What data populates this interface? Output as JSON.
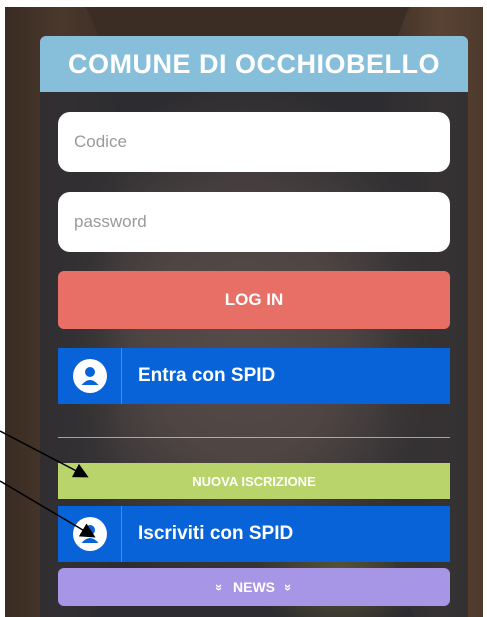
{
  "header": {
    "title": "COMUNE DI OCCHIOBELLO"
  },
  "login": {
    "code_placeholder": "Codice",
    "password_placeholder": "password",
    "login_label": "LOG IN",
    "spid_enter_label": "Entra con SPID"
  },
  "registration": {
    "new_label": "NUOVA ISCRIZIONE",
    "spid_register_label": "Iscriviti con SPID"
  },
  "news": {
    "label": "NEWS",
    "chevron_left": "»",
    "chevron_right": "»"
  },
  "colors": {
    "title_bar": "#87bfdb",
    "login_button": "#e76f66",
    "spid_button": "#0863d8",
    "new_registration": "#b8d46a",
    "news_button": "#a796e6"
  },
  "icons": {
    "spid": "user-circle-icon",
    "news": "chevron-double-down-icon"
  }
}
